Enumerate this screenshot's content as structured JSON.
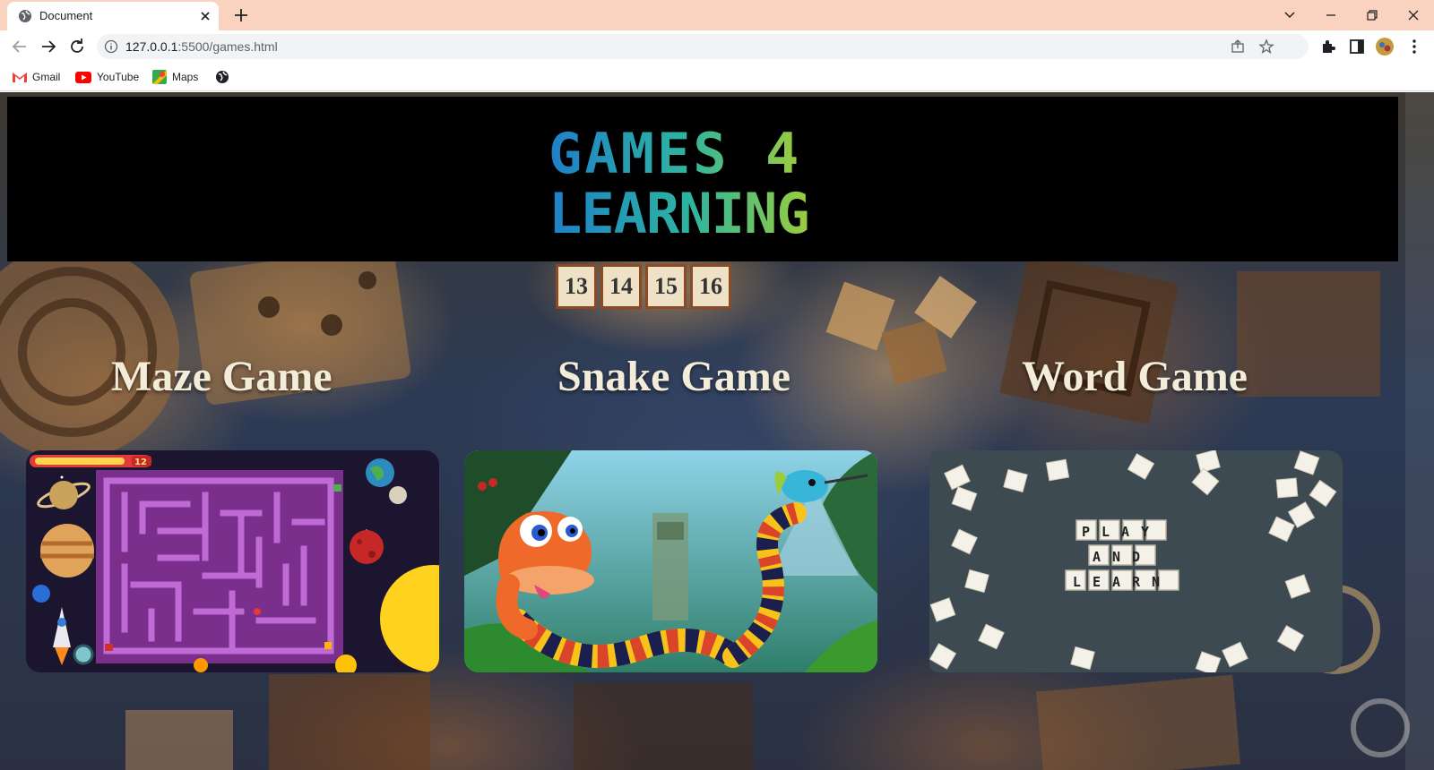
{
  "browser": {
    "tab_title": "Document",
    "url_host": "127.0.0.1",
    "url_rest": ":5500/games.html",
    "bookmarks": [
      "Gmail",
      "YouTube",
      "Maps"
    ]
  },
  "page": {
    "logo_line1": "GAMES 4",
    "logo_line2": "LEARNING",
    "background_tiles": [
      "13",
      "14",
      "15",
      "16"
    ],
    "games": [
      {
        "title": "Maze Game",
        "image_icon": "maze-image",
        "hud_level": "12"
      },
      {
        "title": "Snake Game",
        "image_icon": "snake-image"
      },
      {
        "title": "Word Game",
        "image_icon": "word-tiles-image",
        "tile_words": [
          "PLAY",
          "AND",
          "LEARN"
        ]
      }
    ]
  },
  "colors": {
    "tabstrip": "#f9d3bf",
    "banner": "#000000",
    "title_text": "#f3ecd8",
    "logo_gradient": [
      "#1e7fc9",
      "#2eb5a0",
      "#9ccc3c"
    ]
  }
}
